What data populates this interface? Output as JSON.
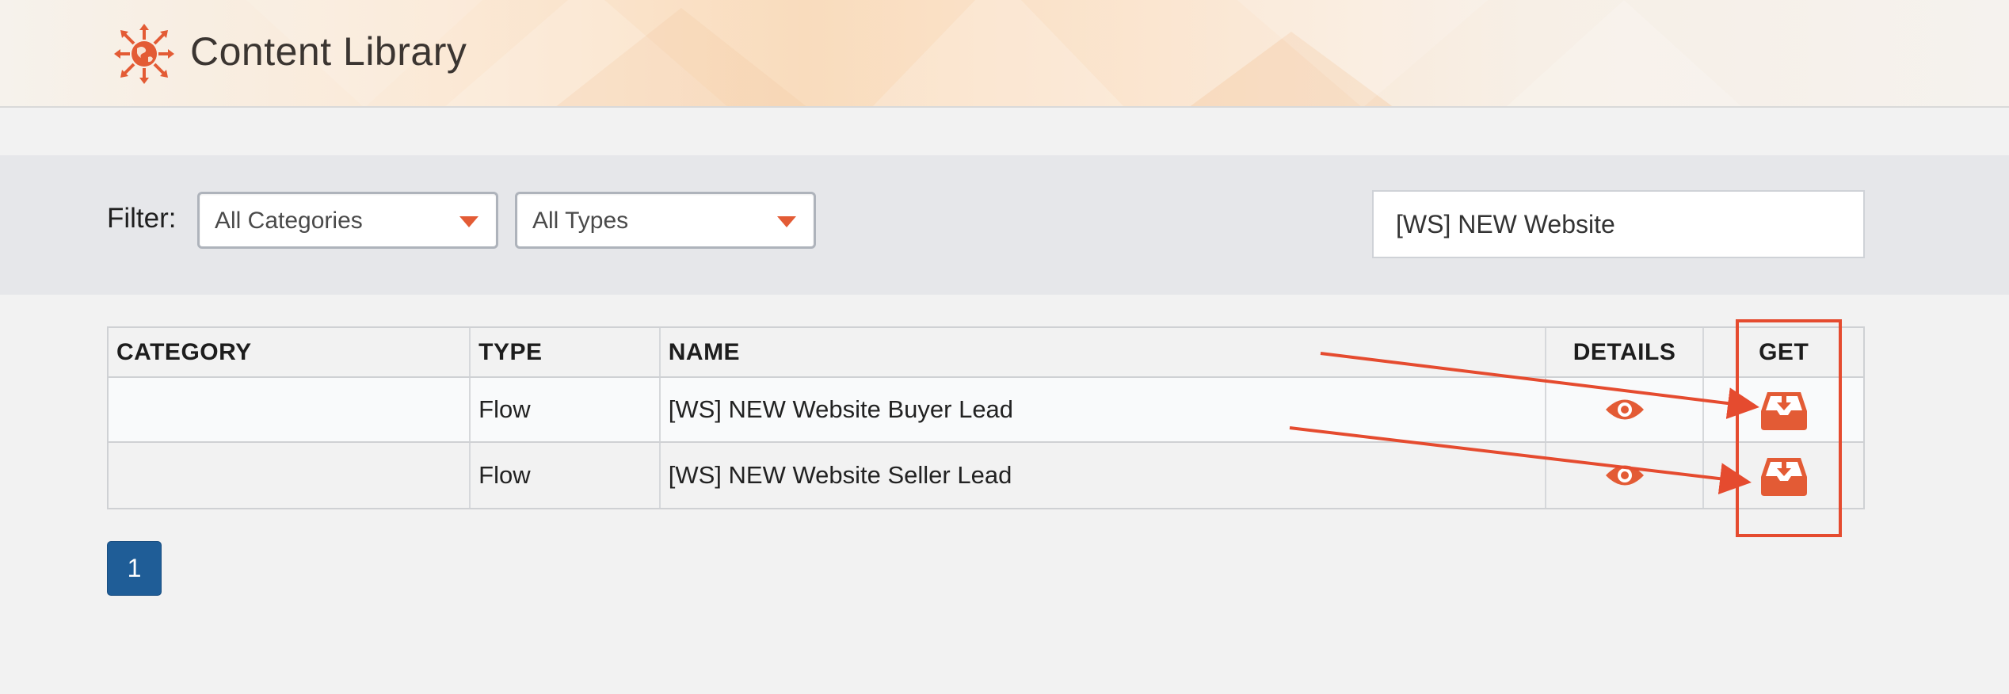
{
  "header": {
    "title": "Content Library",
    "logo_icon": "globe-arrows-icon"
  },
  "filter": {
    "label": "Filter:",
    "category_select": {
      "selected": "All Categories"
    },
    "type_select": {
      "selected": "All Types"
    },
    "search": {
      "value": "[WS] NEW Website"
    }
  },
  "table": {
    "columns": {
      "category": "CATEGORY",
      "type": "TYPE",
      "name": "NAME",
      "details": "DETAILS",
      "get": "GET"
    },
    "rows": [
      {
        "category": "",
        "type": "Flow",
        "name": "[WS] NEW Website Buyer Lead",
        "details_icon": "eye-icon",
        "get_icon": "inbox-download-icon"
      },
      {
        "category": "",
        "type": "Flow",
        "name": "[WS] NEW Website Seller Lead",
        "details_icon": "eye-icon",
        "get_icon": "inbox-download-icon"
      }
    ]
  },
  "pagination": {
    "current_page": "1"
  },
  "colors": {
    "accent": "#e35b35",
    "annotation": "#e54b2f",
    "pagination": "#1f5d97"
  }
}
